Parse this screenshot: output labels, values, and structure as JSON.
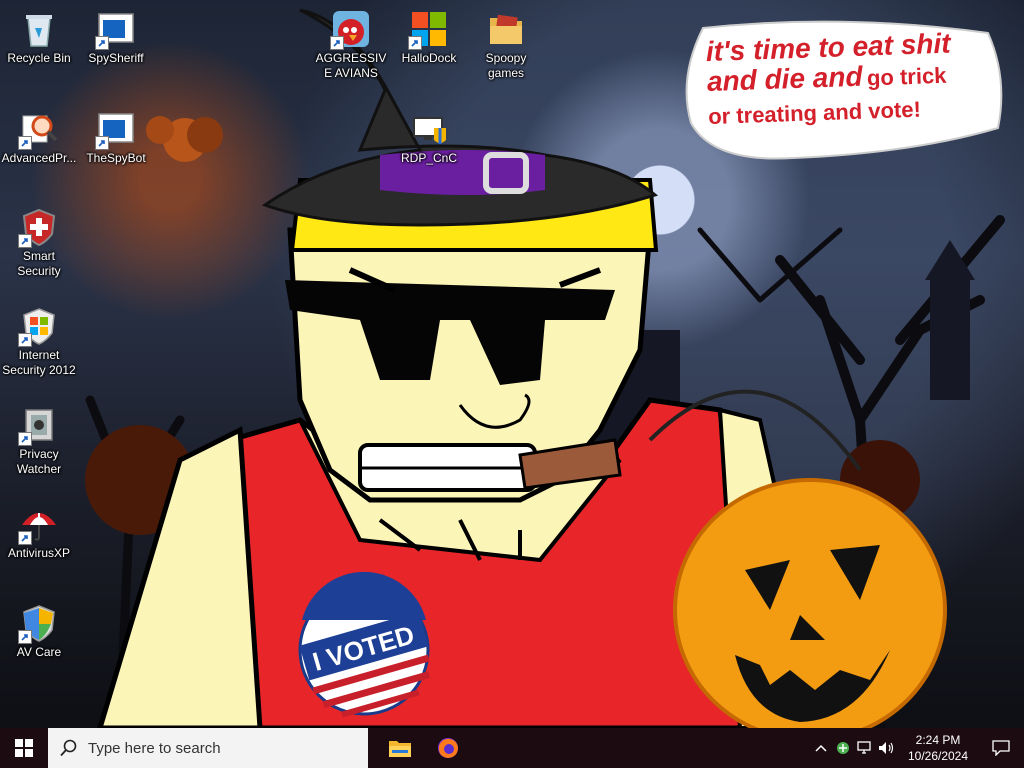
{
  "desktop": {
    "icons": [
      {
        "label": "Recycle Bin",
        "icon": "recycle-bin-icon"
      },
      {
        "label": "SpySheriff",
        "icon": "app-window-icon"
      },
      {
        "label": "AGGRESSIVE AVIANS",
        "icon": "angry-bird-icon"
      },
      {
        "label": "HalloDock",
        "icon": "windows-logo-icon"
      },
      {
        "label": "Spoopy games",
        "icon": "folder-icon"
      },
      {
        "label": "AdvancedPr...",
        "icon": "magnifier-icon"
      },
      {
        "label": "TheSpyBot",
        "icon": "app-window-icon"
      },
      {
        "label": "RDP_CnC",
        "icon": "remote-desktop-icon"
      },
      {
        "label": "Smart Security",
        "icon": "shield-cross-icon"
      },
      {
        "label": "Internet Security 2012",
        "icon": "windows-flag-icon"
      },
      {
        "label": "Privacy Watcher",
        "icon": "speaker-icon"
      },
      {
        "label": "AntivirusXP",
        "icon": "umbrella-icon"
      },
      {
        "label": "AV Care",
        "icon": "windows-shield-icon"
      }
    ]
  },
  "wallpaper": {
    "speech_bubble": {
      "line1": "it's time to eat shit",
      "line2a": "and die and",
      "line2b": "go trick",
      "line3": "or treating and vote!"
    },
    "badge_text": "I VOTED"
  },
  "taskbar": {
    "search_placeholder": "Type here to search",
    "apps": [
      "file-explorer-icon",
      "firefox-icon"
    ],
    "clock": {
      "time": "2:24 PM",
      "date": "10/26/2024"
    }
  }
}
